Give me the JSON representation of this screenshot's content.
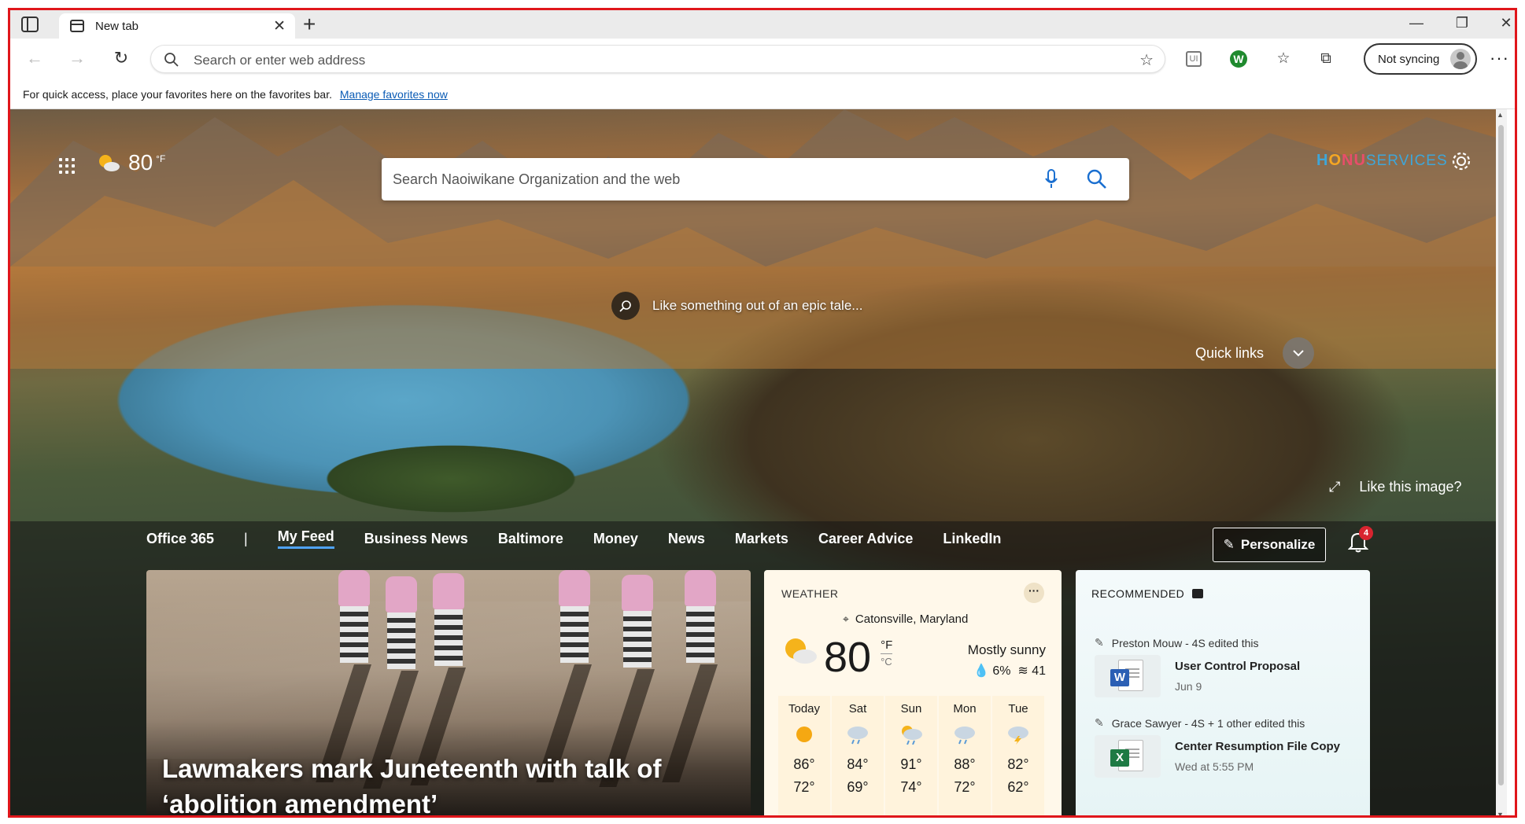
{
  "browser": {
    "tab_title": "New tab",
    "address_placeholder": "Search or enter web address",
    "profile_label": "Not syncing",
    "favorites_bar_text": "For quick access, place your favorites here on the favorites bar.",
    "favorites_bar_link": "Manage favorites now"
  },
  "newtab": {
    "weather_temp": "80",
    "weather_unit": "°F",
    "search_placeholder": "Search Naoiwikane Organization and the web",
    "brand_logo_letters": [
      "H",
      "O",
      "NU",
      "SERVICES"
    ],
    "image_caption": "Like something out of an epic tale...",
    "quick_links_label": "Quick links",
    "like_image_label": "Like this image?"
  },
  "feed": {
    "nav": [
      {
        "label": "Office 365",
        "active": false
      },
      {
        "label": "My Feed",
        "active": true
      },
      {
        "label": "Business News",
        "active": false
      },
      {
        "label": "Baltimore",
        "active": false
      },
      {
        "label": "Money",
        "active": false
      },
      {
        "label": "News",
        "active": false
      },
      {
        "label": "Markets",
        "active": false
      },
      {
        "label": "Career Advice",
        "active": false
      },
      {
        "label": "LinkedIn",
        "active": false
      }
    ],
    "separator": "|",
    "personalize_label": "Personalize",
    "notification_count": "4"
  },
  "hero": {
    "headline": "Lawmakers mark Juneteenth with talk of ‘abolition amendment’"
  },
  "weather": {
    "label": "WEATHER",
    "more": "···",
    "location": "Catonsville, Maryland",
    "temp": "80",
    "unit_f": "°F",
    "unit_c": "°C",
    "condition": "Mostly sunny",
    "precip": "6%",
    "wind": "41",
    "forecast": [
      {
        "day": "Today",
        "icon": "sun-icon",
        "hi": "86°",
        "lo": "72°"
      },
      {
        "day": "Sat",
        "icon": "cloud-rain-icon",
        "hi": "84°",
        "lo": "69°"
      },
      {
        "day": "Sun",
        "icon": "sun-cloud-rain-icon",
        "hi": "91°",
        "lo": "74°"
      },
      {
        "day": "Mon",
        "icon": "cloud-rain-icon",
        "hi": "88°",
        "lo": "72°"
      },
      {
        "day": "Tue",
        "icon": "storm-icon",
        "hi": "82°",
        "lo": "62°"
      }
    ]
  },
  "recommended": {
    "label": "RECOMMENDED",
    "items": [
      {
        "who": "Preston Mouw - 4S edited this",
        "title": "User Control Proposal",
        "date": "Jun 9",
        "app": "W",
        "color": "#2b5fb4"
      },
      {
        "who": "Grace Sawyer - 4S + 1 other edited this",
        "title": "Center Resumption File Copy",
        "date": "Wed at 5:55 PM",
        "app": "X",
        "color": "#1e7a44"
      }
    ]
  },
  "colors": {
    "frame_border": "#e0161b",
    "accent_blue": "#4fa3f7",
    "badge_red": "#d8242f"
  }
}
